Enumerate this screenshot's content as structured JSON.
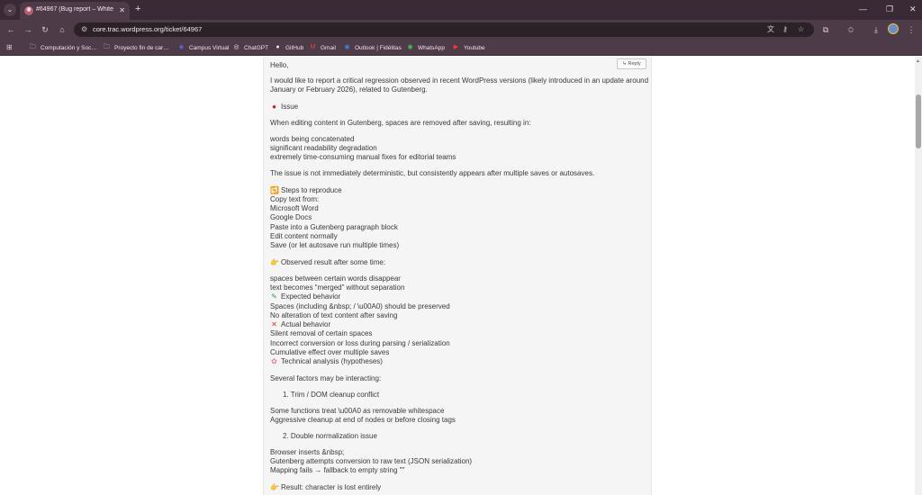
{
  "browser": {
    "tab": {
      "title": "#64967 (Bug report – Whitespace…",
      "favicon_glyph": "✺",
      "close_glyph": "✕"
    },
    "tab_menu_glyph": "⌄",
    "new_tab_glyph": "+",
    "window": {
      "minimize": "—",
      "restore": "❐",
      "close": "✕"
    },
    "nav": {
      "back": "←",
      "forward": "→",
      "reload": "↻",
      "home": "⌂"
    },
    "url": "core.trac.wordpress.org/ticket/64967",
    "omnibox_icons": {
      "site_info": "⚙",
      "translate": "文",
      "password": "⚷",
      "bookmark": "☆"
    },
    "toolbar_icons": {
      "extensions": "⧉",
      "reading_list": "✩",
      "download": "⤓",
      "menu": "⋮"
    },
    "bookmarks": {
      "apps_glyph": "⊞",
      "items": [
        {
          "label": "Computación y Soc…",
          "icon": "🗀",
          "color": "#d8ccd4"
        },
        {
          "label": "Proyecto fin de car…",
          "icon": "🗀",
          "color": "#d8ccd4"
        },
        {
          "label": "Campus Virtual",
          "icon": "◆",
          "color": "#5b5fd0"
        },
        {
          "label": "ChatGPT",
          "icon": "◎",
          "color": "#efe5ec"
        },
        {
          "label": "GitHub",
          "icon": "●",
          "color": "#efe5ec"
        },
        {
          "label": "Gmail",
          "icon": "M",
          "color": "#e0463a"
        },
        {
          "label": "Outlook | Fidélitas",
          "icon": "◉",
          "color": "#2f8be0"
        },
        {
          "label": "WhatsApp",
          "icon": "◉",
          "color": "#3fc25a"
        },
        {
          "label": "Youtube",
          "icon": "▶",
          "color": "#f03a32"
        }
      ]
    }
  },
  "comment": {
    "reply_label": "↳ Reply",
    "lines": [
      {
        "text": "Hello,"
      },
      {
        "text": "I would like to report a critical regression observed in recent WordPress versions (likely introduced in an update around"
      },
      {
        "text": "January or February 2026), related to Gutenberg."
      },
      {
        "text": "Issue",
        "emoji": "●",
        "emoji_class": "red",
        "emoji_name": "red-circle-icon"
      },
      {
        "text": "When editing content in Gutenberg, spaces are removed after saving, resulting in:"
      },
      {
        "text": "words being concatenated"
      },
      {
        "text": "significant readability degradation"
      },
      {
        "text": "extremely time-consuming manual fixes for editorial teams"
      },
      {
        "text": "The issue is not immediately deterministic, but consistently appears after multiple saves or autosaves."
      },
      {
        "text": "Steps to reproduce",
        "emoji": "🔁",
        "emoji_class": "blue",
        "emoji_name": "repeat-icon"
      },
      {
        "text": "Copy text from:"
      },
      {
        "text": "Microsoft Word"
      },
      {
        "text": "Google Docs"
      },
      {
        "text": "Paste into a Gutenberg paragraph block"
      },
      {
        "text": "Edit content normally"
      },
      {
        "text": "Save (or let autosave run multiple times)"
      },
      {
        "text": "Observed result after some time:",
        "emoji": "👉",
        "emoji_class": "hand",
        "emoji_name": "pointing-hand-icon"
      },
      {
        "text": "spaces between certain words disappear"
      },
      {
        "text": "text becomes “merged” without separation"
      },
      {
        "text": "Expected behavior",
        "emoji": "✎",
        "emoji_class": "pencil",
        "emoji_name": "pencil-icon"
      },
      {
        "text": "Spaces (including &nbsp; / \\u00A0) should be preserved"
      },
      {
        "text": "No alteration of text content after saving"
      },
      {
        "text": "Actual behavior",
        "emoji": "✕",
        "emoji_class": "cross",
        "emoji_name": "cross-mark-icon"
      },
      {
        "text": "Silent removal of certain spaces"
      },
      {
        "text": "Incorrect conversion or loss during parsing / serialization"
      },
      {
        "text": "Cumulative effect over multiple saves"
      },
      {
        "text": "Technical analysis (hypotheses)",
        "emoji": "✿",
        "emoji_class": "brain",
        "emoji_name": "brain-icon"
      },
      {
        "text": "Several factors may be interacting:"
      },
      {
        "text": "1. Trim / DOM cleanup conflict",
        "indent": true
      },
      {
        "text": "Some functions treat \\u00A0 as removable whitespace"
      },
      {
        "text": "Aggressive cleanup at end of nodes or before closing tags"
      },
      {
        "text": "2. Double normalization issue",
        "indent": true
      },
      {
        "text": "Browser inserts &nbsp;"
      },
      {
        "text": "Gutenberg attempts conversion to raw text (JSON serialization)"
      },
      {
        "text": "Mapping fails → fallback to empty string \"\""
      },
      {
        "text": "Result: character is lost entirely",
        "emoji": "👉",
        "emoji_class": "hand",
        "emoji_name": "pointing-hand-icon"
      }
    ]
  }
}
